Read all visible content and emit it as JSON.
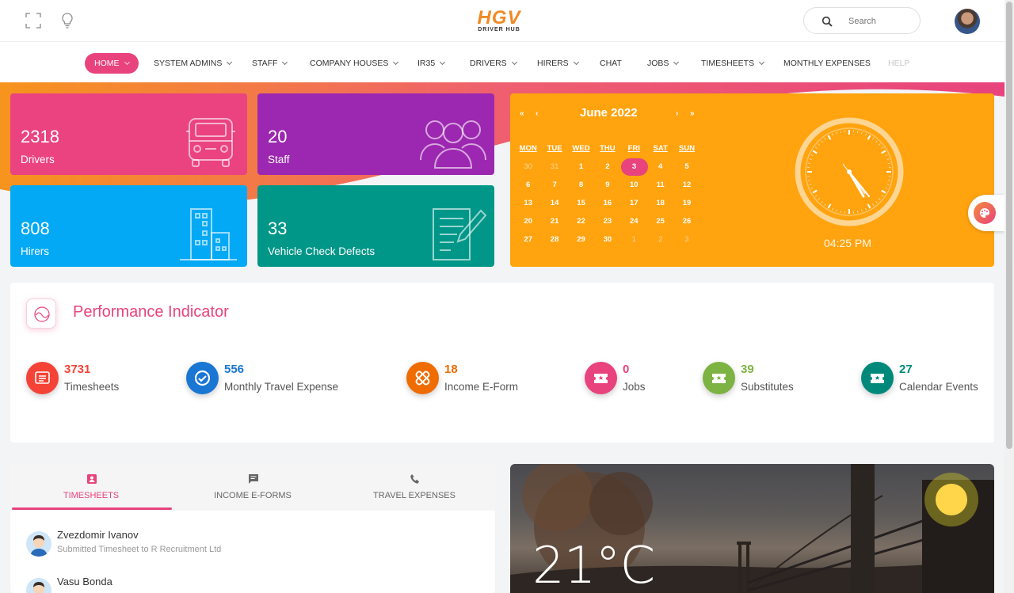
{
  "header": {
    "logo_main": "HGV",
    "logo_sub": "DRIVER HUB",
    "search_placeholder": "Search"
  },
  "nav": {
    "items": [
      {
        "label": "HOME",
        "dropdown": true,
        "active": true
      },
      {
        "label": "SYSTEM ADMINS",
        "dropdown": true
      },
      {
        "label": "STAFF",
        "dropdown": true
      },
      {
        "label": "COMPANY HOUSES",
        "dropdown": true
      },
      {
        "label": "IR35",
        "dropdown": true
      },
      {
        "label": "DRIVERS",
        "dropdown": true
      },
      {
        "label": "HIRERS",
        "dropdown": true
      },
      {
        "label": "CHAT",
        "dropdown": false
      },
      {
        "label": "JOBS",
        "dropdown": true
      },
      {
        "label": "TIMESHEETS",
        "dropdown": true
      },
      {
        "label": "MONTHLY EXPENSES",
        "dropdown": false
      },
      {
        "label": "HELP",
        "dropdown": false,
        "disabled": true
      }
    ]
  },
  "stats": {
    "drivers": {
      "value": "2318",
      "label": "Drivers",
      "color": "#ea4380",
      "icon": "truck-icon"
    },
    "staff": {
      "value": "20",
      "label": "Staff",
      "color": "#9c27b0",
      "icon": "group-icon"
    },
    "hirers": {
      "value": "808",
      "label": "Hirers",
      "color": "#03a9f4",
      "icon": "buildings-icon"
    },
    "defects": {
      "value": "33",
      "label": "Vehicle Check Defects",
      "color": "#009688",
      "icon": "document-pen-icon"
    }
  },
  "calendar": {
    "title": "June 2022",
    "nav": {
      "prev_year": "«",
      "prev": "‹",
      "next": "›",
      "next_year": "»"
    },
    "weekdays": [
      "MON",
      "TUE",
      "WED",
      "THU",
      "FRI",
      "SAT",
      "SUN"
    ],
    "weeks": [
      [
        {
          "d": "30",
          "m": true
        },
        {
          "d": "31",
          "m": true
        },
        {
          "d": "1"
        },
        {
          "d": "2"
        },
        {
          "d": "3",
          "today": true
        },
        {
          "d": "4"
        },
        {
          "d": "5"
        }
      ],
      [
        {
          "d": "6"
        },
        {
          "d": "7"
        },
        {
          "d": "8"
        },
        {
          "d": "9"
        },
        {
          "d": "10"
        },
        {
          "d": "11"
        },
        {
          "d": "12"
        }
      ],
      [
        {
          "d": "13"
        },
        {
          "d": "14"
        },
        {
          "d": "15"
        },
        {
          "d": "16"
        },
        {
          "d": "17"
        },
        {
          "d": "18"
        },
        {
          "d": "19"
        }
      ],
      [
        {
          "d": "20"
        },
        {
          "d": "21"
        },
        {
          "d": "22"
        },
        {
          "d": "23"
        },
        {
          "d": "24"
        },
        {
          "d": "25"
        },
        {
          "d": "26"
        }
      ],
      [
        {
          "d": "27"
        },
        {
          "d": "28"
        },
        {
          "d": "29"
        },
        {
          "d": "30"
        },
        {
          "d": "1",
          "m": true
        },
        {
          "d": "2",
          "m": true
        },
        {
          "d": "3",
          "m": true
        }
      ]
    ],
    "time": "04:25 PM",
    "color": "#ffa30f"
  },
  "performance": {
    "title": "Performance Indicator",
    "kpis": [
      {
        "value": "3731",
        "label": "Timesheets",
        "color": "#f44336",
        "icon": "list-icon"
      },
      {
        "value": "556",
        "label": "Monthly Travel Expense",
        "color": "#1976d2",
        "icon": "check-circle-icon"
      },
      {
        "value": "18",
        "label": "Income E-Form",
        "color": "#ef6c00",
        "icon": "bandage-icon"
      },
      {
        "value": "0",
        "label": "Jobs",
        "color": "#e8437d",
        "icon": "ticket-icon"
      },
      {
        "value": "39",
        "label": "Substitutes",
        "color": "#7cb342",
        "icon": "ticket-star-icon"
      },
      {
        "value": "27",
        "label": "Calendar Events",
        "color": "#00897b",
        "icon": "ticket-star-icon"
      }
    ]
  },
  "tabs": {
    "items": [
      {
        "label": "TIMESHEETS",
        "icon": "badge-icon",
        "active": true
      },
      {
        "label": "INCOME E-FORMS",
        "icon": "chat-icon"
      },
      {
        "label": "TRAVEL EXPENSES",
        "icon": "phone-icon"
      }
    ],
    "entries": [
      {
        "name": "Zvezdomir Ivanov",
        "sub": "Submitted Timesheet to R Recruitment Ltd"
      },
      {
        "name": "Vasu Bonda",
        "sub": ""
      }
    ]
  },
  "weather": {
    "temp": "21°C"
  }
}
